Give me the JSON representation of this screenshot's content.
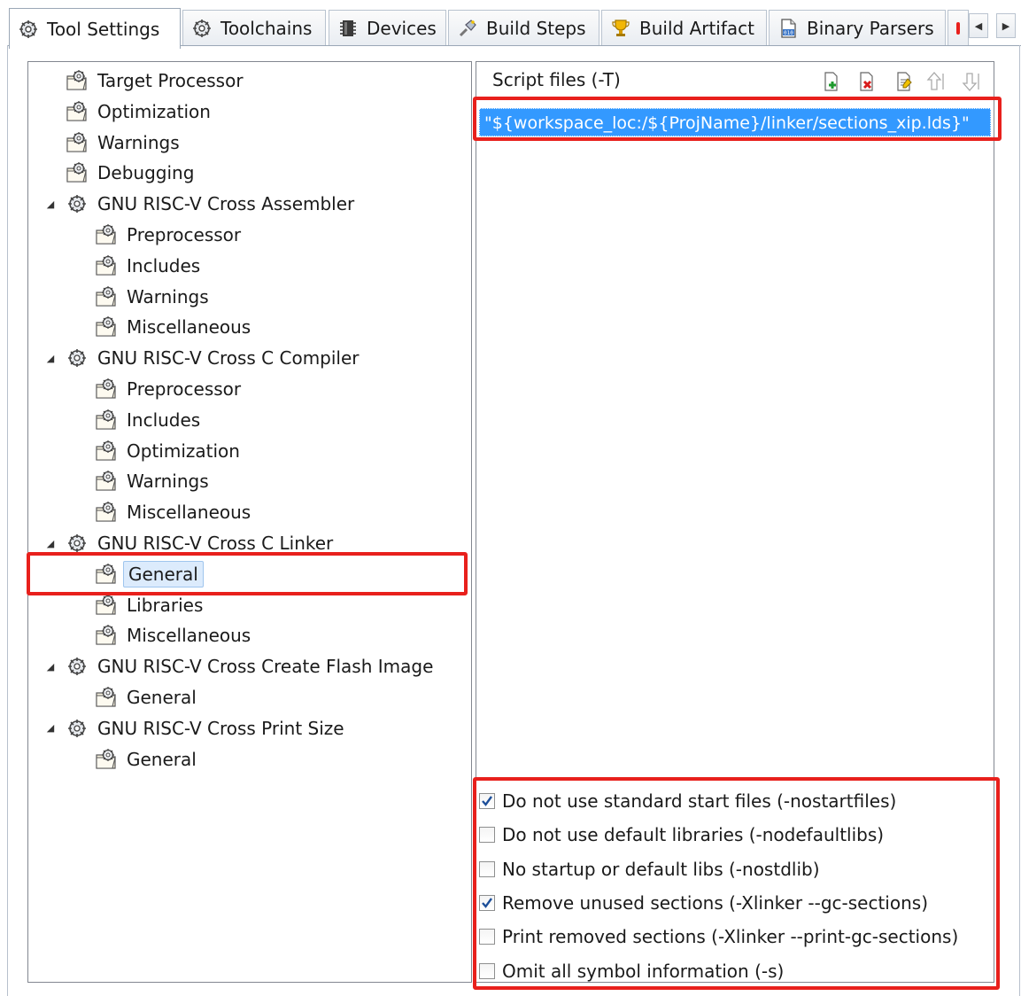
{
  "tabs": [
    {
      "label": "Tool Settings",
      "icon": "tool-settings-icon",
      "active": true
    },
    {
      "label": "Toolchains",
      "icon": "toolchains-icon",
      "active": false
    },
    {
      "label": "Devices",
      "icon": "devices-icon",
      "active": false
    },
    {
      "label": "Build Steps",
      "icon": "build-steps-icon",
      "active": false
    },
    {
      "label": "Build Artifact",
      "icon": "build-artifact-icon",
      "active": false
    },
    {
      "label": "Binary Parsers",
      "icon": "binary-parsers-icon",
      "active": false
    }
  ],
  "tree": {
    "items": [
      {
        "label": "Target Processor",
        "level": 0,
        "expanded": null
      },
      {
        "label": "Optimization",
        "level": 0,
        "expanded": null
      },
      {
        "label": "Warnings",
        "level": 0,
        "expanded": null
      },
      {
        "label": "Debugging",
        "level": 0,
        "expanded": null
      },
      {
        "label": "GNU RISC-V Cross Assembler",
        "level": 0,
        "expanded": true
      },
      {
        "label": "Preprocessor",
        "level": 1,
        "expanded": null
      },
      {
        "label": "Includes",
        "level": 1,
        "expanded": null
      },
      {
        "label": "Warnings",
        "level": 1,
        "expanded": null
      },
      {
        "label": "Miscellaneous",
        "level": 1,
        "expanded": null
      },
      {
        "label": "GNU RISC-V Cross C Compiler",
        "level": 0,
        "expanded": true
      },
      {
        "label": "Preprocessor",
        "level": 1,
        "expanded": null
      },
      {
        "label": "Includes",
        "level": 1,
        "expanded": null
      },
      {
        "label": "Optimization",
        "level": 1,
        "expanded": null
      },
      {
        "label": "Warnings",
        "level": 1,
        "expanded": null
      },
      {
        "label": "Miscellaneous",
        "level": 1,
        "expanded": null
      },
      {
        "label": "GNU RISC-V Cross C Linker",
        "level": 0,
        "expanded": true
      },
      {
        "label": "General",
        "level": 1,
        "expanded": null,
        "selected": true
      },
      {
        "label": "Libraries",
        "level": 1,
        "expanded": null
      },
      {
        "label": "Miscellaneous",
        "level": 1,
        "expanded": null
      },
      {
        "label": "GNU RISC-V Cross Create Flash Image",
        "level": 0,
        "expanded": true
      },
      {
        "label": "General",
        "level": 1,
        "expanded": null
      },
      {
        "label": "GNU RISC-V Cross Print Size",
        "level": 0,
        "expanded": true
      },
      {
        "label": "General",
        "level": 1,
        "expanded": null
      }
    ]
  },
  "script_files": {
    "title": "Script files (-T)",
    "toolbar": [
      "add-icon",
      "delete-icon",
      "edit-icon",
      "move-up-icon",
      "move-down-icon"
    ],
    "items": [
      "\"${workspace_loc:/${ProjName}/linker/sections_xip.lds}\""
    ]
  },
  "options": [
    {
      "label": "Do not use standard start files (-nostartfiles)",
      "checked": true
    },
    {
      "label": "Do not use default libraries (-nodefaultlibs)",
      "checked": false
    },
    {
      "label": "No startup or default libs (-nostdlib)",
      "checked": false
    },
    {
      "label": "Remove unused sections (-Xlinker --gc-sections)",
      "checked": true
    },
    {
      "label": "Print removed sections (-Xlinker --print-gc-sections)",
      "checked": false
    },
    {
      "label": "Omit all symbol information (-s)",
      "checked": false
    }
  ],
  "colors": {
    "highlight_border": "#e8201c",
    "selection_blue": "#3399ff",
    "tree_selection": "#dcebfc"
  }
}
